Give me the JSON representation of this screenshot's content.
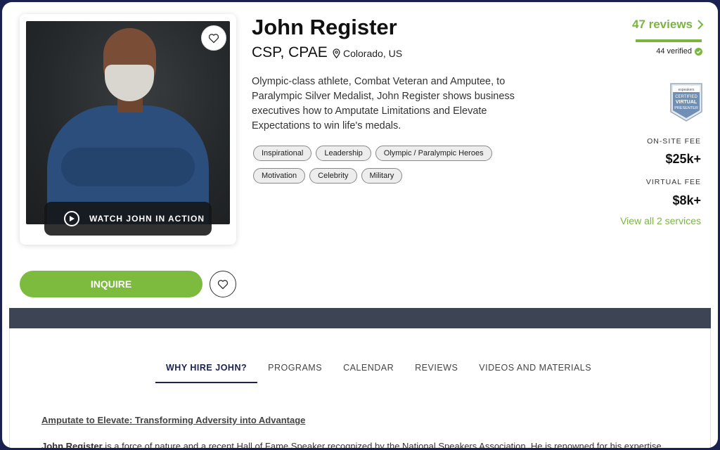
{
  "profile": {
    "name": "John Register",
    "credentials": "CSP, CPAE",
    "location": "Colorado, US",
    "description": "Olympic-class athlete, Combat Veteran and Amputee, to Paralympic Silver Medalist, John Register shows business executives how to Amputate Limitations and Elevate Expectations to win life's medals.",
    "tags": [
      "Inspirational",
      "Leadership",
      "Olympic / Paralympic Heroes",
      "Motivation",
      "Celebrity",
      "Military"
    ]
  },
  "media": {
    "watch_label": "WATCH JOHN IN ACTION"
  },
  "reviews": {
    "label": "47 reviews",
    "verified": "44 verified"
  },
  "badge": {
    "line1": "espeakers",
    "line2": "CERTIFIED",
    "line3": "VIRTUAL",
    "line4": "PRESENTER"
  },
  "fees": {
    "onsite_label": "ON-SITE FEE",
    "onsite_value": "$25k+",
    "virtual_label": "VIRTUAL FEE",
    "virtual_value": "$8k+",
    "services_link": "View all 2 services"
  },
  "actions": {
    "inquire": "INQUIRE"
  },
  "tabs": [
    {
      "label": "WHY HIRE JOHN?",
      "active": true
    },
    {
      "label": "PROGRAMS"
    },
    {
      "label": "CALENDAR"
    },
    {
      "label": "REVIEWS"
    },
    {
      "label": "VIDEOS AND MATERIALS"
    }
  ],
  "content": {
    "section_title": "Amputate to Elevate: Transforming Adversity into Advantage",
    "body_name": "John Register",
    "body_rest": " is a force of nature and a recent Hall of Fame Speaker recognized by the National Speakers Association. He is renowned for his expertise"
  },
  "colors": {
    "accent_green": "#7ab540",
    "navy": "#1b2250",
    "band": "#3d4453"
  }
}
